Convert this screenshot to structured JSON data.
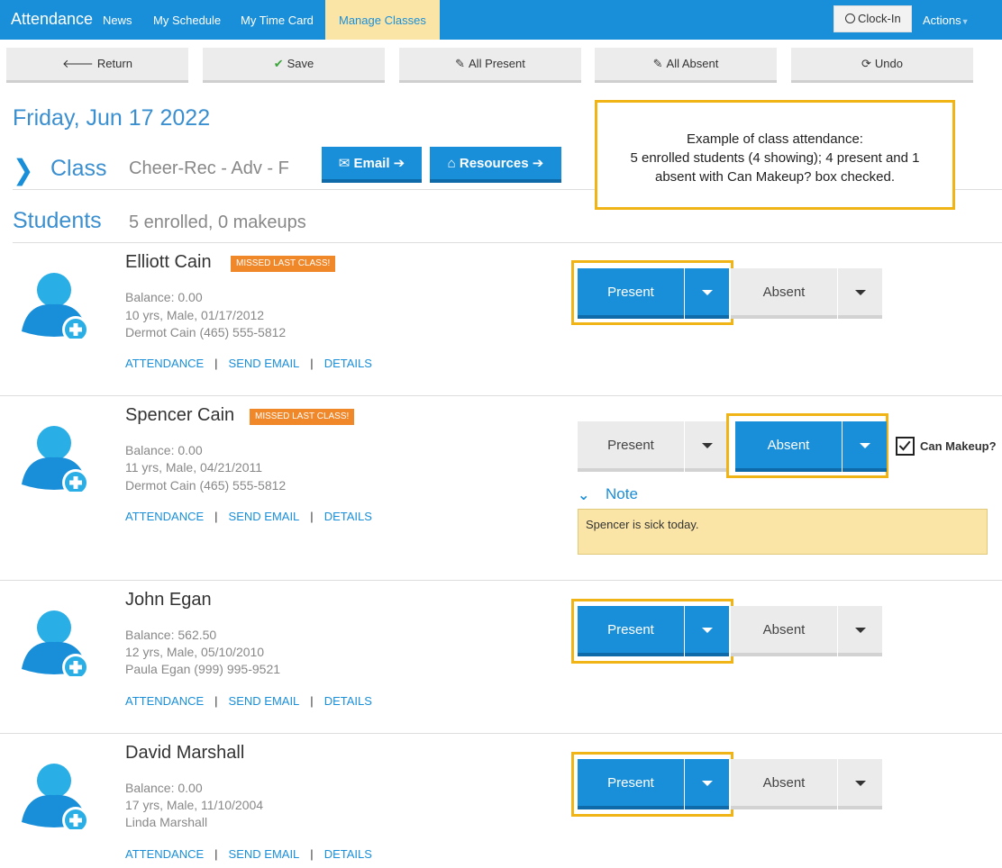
{
  "nav": {
    "brand": "Attendance",
    "links": [
      "News",
      "My Schedule",
      "My Time Card",
      "Manage Classes"
    ],
    "clock_in": "Clock-In",
    "actions": "Actions"
  },
  "toolbar": {
    "return": "Return",
    "save": "Save",
    "all_present": "All Present",
    "all_absent": "All Absent",
    "undo": "Undo"
  },
  "header": {
    "date": "Friday, Jun 17 2022",
    "class_label": "Class",
    "class_name": "Cheer-Rec - Adv - F",
    "email_btn": "Email",
    "resources_btn": "Resources",
    "students_label": "Students",
    "enrolled": "5 enrolled, 0 makeups"
  },
  "callout": {
    "line1": "Example of class attendance:",
    "line2": "5 enrolled students (4 showing); 4 present and 1",
    "line3": "absent with Can Makeup? box checked."
  },
  "labels": {
    "present": "Present",
    "absent": "Absent",
    "attendance": "ATTENDANCE",
    "send_email": "SEND EMAIL",
    "details": "DETAILS",
    "missed": "MISSED LAST CLASS!",
    "can_makeup": "Can Makeup?",
    "note": "Note"
  },
  "students": [
    {
      "name": "Elliott Cain",
      "missed": true,
      "balance": "Balance: 0.00",
      "age": "10 yrs, Male, 01/17/2012",
      "contact": "Dermot Cain (465) 555-5812",
      "status": "present"
    },
    {
      "name": "Spencer Cain",
      "missed": true,
      "balance": "Balance: 0.00",
      "age": "11 yrs, Male, 04/21/2011",
      "contact": "Dermot Cain (465) 555-5812",
      "status": "absent",
      "can_makeup": true,
      "note": "Spencer is sick today."
    },
    {
      "name": "John Egan",
      "missed": false,
      "balance": "Balance: 562.50",
      "age": "12 yrs, Male, 05/10/2010",
      "contact": "Paula Egan (999) 995-9521",
      "status": "present"
    },
    {
      "name": "David Marshall",
      "missed": false,
      "balance": "Balance: 0.00",
      "age": "17 yrs, Male, 11/10/2004",
      "contact": "Linda Marshall",
      "status": "present"
    }
  ],
  "colors": {
    "primary": "#1a8fd9",
    "highlight": "#f0b416",
    "badge": "#f0882a",
    "note_bg": "#fbe5a6"
  }
}
